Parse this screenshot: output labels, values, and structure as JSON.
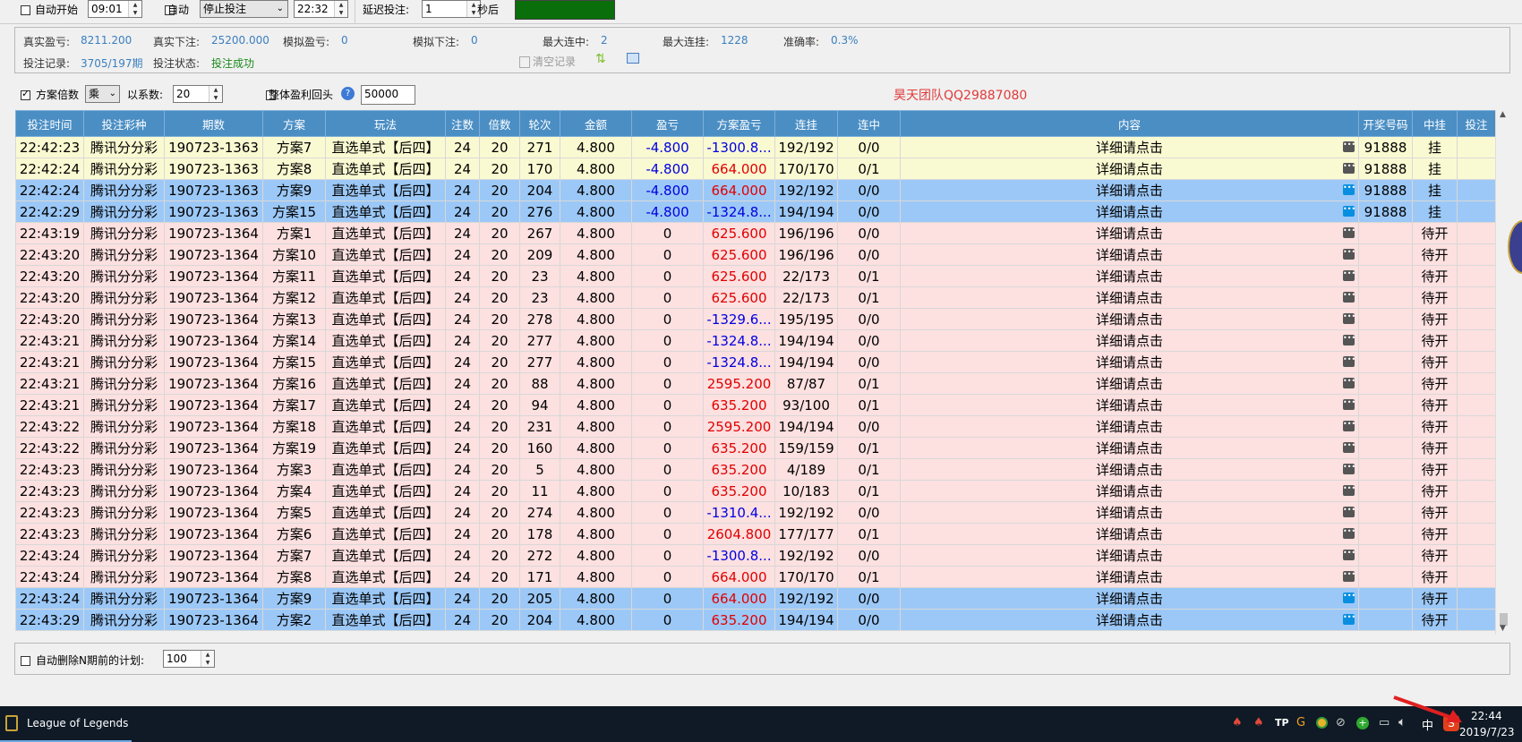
{
  "toolbar": {
    "auto_start_label": "自动开始",
    "start_time": "09:01",
    "auto_label": "自动",
    "auto_action": "停止投注",
    "end_time": "22:32",
    "delay_label": "延迟投注:",
    "delay_value": "1",
    "delay_unit": "秒后"
  },
  "stats": {
    "real_pl_label": "真实盈亏:",
    "real_pl": "8211.200",
    "real_bet_label": "真实下注:",
    "real_bet": "25200.000",
    "sim_pl_label": "模拟盈亏:",
    "sim_pl": "0",
    "sim_bet_label": "模拟下注:",
    "sim_bet": "0",
    "max_win_label": "最大连中:",
    "max_win": "2",
    "max_lose_label": "最大连挂:",
    "max_lose": "1228",
    "accuracy_label": "准确率:",
    "accuracy": "0.3%",
    "record_label": "投注记录:",
    "record": "3705/197期",
    "status_label": "投注状态:",
    "status": "投注成功",
    "clear_label": "清空记录"
  },
  "options": {
    "multiplier_label": "方案倍数",
    "multiply_op": "乘",
    "factor_label": "以系数:",
    "factor": "20",
    "overall_label": "整体盈利回头",
    "overall_value": "50000",
    "watermark": "昊天团队QQ29887080"
  },
  "table": {
    "headers": [
      "投注时间",
      "投注彩种",
      "期数",
      "方案",
      "玩法",
      "注数",
      "倍数",
      "轮次",
      "金额",
      "盈亏",
      "方案盈亏",
      "连挂",
      "连中",
      "内容",
      "开奖号码",
      "中挂",
      "投注"
    ],
    "rows": [
      {
        "style": "y",
        "c": [
          "22:42:23",
          "腾讯分分彩",
          "190723-1363",
          "方案7",
          "直选单式【后四】",
          "24",
          "20",
          "271",
          "4.800",
          "-4.800",
          "-1300.8...",
          "192/192",
          "0/0",
          "详细请点击",
          "91888",
          "挂",
          ""
        ],
        "pl": "neg",
        "spl": "neg",
        "dot": "gray"
      },
      {
        "style": "y",
        "c": [
          "22:42:24",
          "腾讯分分彩",
          "190723-1363",
          "方案8",
          "直选单式【后四】",
          "24",
          "20",
          "170",
          "4.800",
          "-4.800",
          "664.000",
          "170/170",
          "0/1",
          "详细请点击",
          "91888",
          "挂",
          ""
        ],
        "pl": "neg",
        "spl": "pos",
        "dot": "gray"
      },
      {
        "style": "b",
        "c": [
          "22:42:24",
          "腾讯分分彩",
          "190723-1363",
          "方案9",
          "直选单式【后四】",
          "24",
          "20",
          "204",
          "4.800",
          "-4.800",
          "664.000",
          "192/192",
          "0/0",
          "详细请点击",
          "91888",
          "挂",
          ""
        ],
        "pl": "neg",
        "spl": "pos",
        "dot": "blue"
      },
      {
        "style": "b",
        "c": [
          "22:42:29",
          "腾讯分分彩",
          "190723-1363",
          "方案15",
          "直选单式【后四】",
          "24",
          "20",
          "276",
          "4.800",
          "-4.800",
          "-1324.8...",
          "194/194",
          "0/0",
          "详细请点击",
          "91888",
          "挂",
          ""
        ],
        "pl": "neg",
        "spl": "neg",
        "dot": "blue"
      },
      {
        "style": "p",
        "c": [
          "22:43:19",
          "腾讯分分彩",
          "190723-1364",
          "方案1",
          "直选单式【后四】",
          "24",
          "20",
          "267",
          "4.800",
          "0",
          "625.600",
          "196/196",
          "0/0",
          "详细请点击",
          "",
          "待开",
          ""
        ],
        "pl": "",
        "spl": "pos",
        "dot": "gray"
      },
      {
        "style": "p",
        "c": [
          "22:43:20",
          "腾讯分分彩",
          "190723-1364",
          "方案10",
          "直选单式【后四】",
          "24",
          "20",
          "209",
          "4.800",
          "0",
          "625.600",
          "196/196",
          "0/0",
          "详细请点击",
          "",
          "待开",
          ""
        ],
        "pl": "",
        "spl": "pos",
        "dot": "gray"
      },
      {
        "style": "p",
        "c": [
          "22:43:20",
          "腾讯分分彩",
          "190723-1364",
          "方案11",
          "直选单式【后四】",
          "24",
          "20",
          "23",
          "4.800",
          "0",
          "625.600",
          "22/173",
          "0/1",
          "详细请点击",
          "",
          "待开",
          ""
        ],
        "pl": "",
        "spl": "pos",
        "dot": "gray"
      },
      {
        "style": "p",
        "c": [
          "22:43:20",
          "腾讯分分彩",
          "190723-1364",
          "方案12",
          "直选单式【后四】",
          "24",
          "20",
          "23",
          "4.800",
          "0",
          "625.600",
          "22/173",
          "0/1",
          "详细请点击",
          "",
          "待开",
          ""
        ],
        "pl": "",
        "spl": "pos",
        "dot": "gray"
      },
      {
        "style": "p",
        "c": [
          "22:43:20",
          "腾讯分分彩",
          "190723-1364",
          "方案13",
          "直选单式【后四】",
          "24",
          "20",
          "278",
          "4.800",
          "0",
          "-1329.6...",
          "195/195",
          "0/0",
          "详细请点击",
          "",
          "待开",
          ""
        ],
        "pl": "",
        "spl": "neg",
        "dot": "gray"
      },
      {
        "style": "p",
        "c": [
          "22:43:21",
          "腾讯分分彩",
          "190723-1364",
          "方案14",
          "直选单式【后四】",
          "24",
          "20",
          "277",
          "4.800",
          "0",
          "-1324.8...",
          "194/194",
          "0/0",
          "详细请点击",
          "",
          "待开",
          ""
        ],
        "pl": "",
        "spl": "neg",
        "dot": "gray"
      },
      {
        "style": "p",
        "c": [
          "22:43:21",
          "腾讯分分彩",
          "190723-1364",
          "方案15",
          "直选单式【后四】",
          "24",
          "20",
          "277",
          "4.800",
          "0",
          "-1324.8...",
          "194/194",
          "0/0",
          "详细请点击",
          "",
          "待开",
          ""
        ],
        "pl": "",
        "spl": "neg",
        "dot": "gray"
      },
      {
        "style": "p",
        "c": [
          "22:43:21",
          "腾讯分分彩",
          "190723-1364",
          "方案16",
          "直选单式【后四】",
          "24",
          "20",
          "88",
          "4.800",
          "0",
          "2595.200",
          "87/87",
          "0/1",
          "详细请点击",
          "",
          "待开",
          ""
        ],
        "pl": "",
        "spl": "pos",
        "dot": "gray"
      },
      {
        "style": "p",
        "c": [
          "22:43:21",
          "腾讯分分彩",
          "190723-1364",
          "方案17",
          "直选单式【后四】",
          "24",
          "20",
          "94",
          "4.800",
          "0",
          "635.200",
          "93/100",
          "0/1",
          "详细请点击",
          "",
          "待开",
          ""
        ],
        "pl": "",
        "spl": "pos",
        "dot": "gray"
      },
      {
        "style": "p",
        "c": [
          "22:43:22",
          "腾讯分分彩",
          "190723-1364",
          "方案18",
          "直选单式【后四】",
          "24",
          "20",
          "231",
          "4.800",
          "0",
          "2595.200",
          "194/194",
          "0/0",
          "详细请点击",
          "",
          "待开",
          ""
        ],
        "pl": "",
        "spl": "pos",
        "dot": "gray"
      },
      {
        "style": "p",
        "c": [
          "22:43:22",
          "腾讯分分彩",
          "190723-1364",
          "方案19",
          "直选单式【后四】",
          "24",
          "20",
          "160",
          "4.800",
          "0",
          "635.200",
          "159/159",
          "0/1",
          "详细请点击",
          "",
          "待开",
          ""
        ],
        "pl": "",
        "spl": "pos",
        "dot": "gray"
      },
      {
        "style": "p",
        "c": [
          "22:43:23",
          "腾讯分分彩",
          "190723-1364",
          "方案3",
          "直选单式【后四】",
          "24",
          "20",
          "5",
          "4.800",
          "0",
          "635.200",
          "4/189",
          "0/1",
          "详细请点击",
          "",
          "待开",
          ""
        ],
        "pl": "",
        "spl": "pos",
        "dot": "gray"
      },
      {
        "style": "p",
        "c": [
          "22:43:23",
          "腾讯分分彩",
          "190723-1364",
          "方案4",
          "直选单式【后四】",
          "24",
          "20",
          "11",
          "4.800",
          "0",
          "635.200",
          "10/183",
          "0/1",
          "详细请点击",
          "",
          "待开",
          ""
        ],
        "pl": "",
        "spl": "pos",
        "dot": "gray"
      },
      {
        "style": "p",
        "c": [
          "22:43:23",
          "腾讯分分彩",
          "190723-1364",
          "方案5",
          "直选单式【后四】",
          "24",
          "20",
          "274",
          "4.800",
          "0",
          "-1310.4...",
          "192/192",
          "0/0",
          "详细请点击",
          "",
          "待开",
          ""
        ],
        "pl": "",
        "spl": "neg",
        "dot": "gray"
      },
      {
        "style": "p",
        "c": [
          "22:43:23",
          "腾讯分分彩",
          "190723-1364",
          "方案6",
          "直选单式【后四】",
          "24",
          "20",
          "178",
          "4.800",
          "0",
          "2604.800",
          "177/177",
          "0/1",
          "详细请点击",
          "",
          "待开",
          ""
        ],
        "pl": "",
        "spl": "pos",
        "dot": "gray"
      },
      {
        "style": "p",
        "c": [
          "22:43:24",
          "腾讯分分彩",
          "190723-1364",
          "方案7",
          "直选单式【后四】",
          "24",
          "20",
          "272",
          "4.800",
          "0",
          "-1300.8...",
          "192/192",
          "0/0",
          "详细请点击",
          "",
          "待开",
          ""
        ],
        "pl": "",
        "spl": "neg",
        "dot": "gray"
      },
      {
        "style": "p",
        "c": [
          "22:43:24",
          "腾讯分分彩",
          "190723-1364",
          "方案8",
          "直选单式【后四】",
          "24",
          "20",
          "171",
          "4.800",
          "0",
          "664.000",
          "170/170",
          "0/1",
          "详细请点击",
          "",
          "待开",
          ""
        ],
        "pl": "",
        "spl": "pos",
        "dot": "gray"
      },
      {
        "style": "b",
        "c": [
          "22:43:24",
          "腾讯分分彩",
          "190723-1364",
          "方案9",
          "直选单式【后四】",
          "24",
          "20",
          "205",
          "4.800",
          "0",
          "664.000",
          "192/192",
          "0/0",
          "详细请点击",
          "",
          "待开",
          ""
        ],
        "pl": "",
        "spl": "pos",
        "dot": "blue"
      },
      {
        "style": "b",
        "c": [
          "22:43:29",
          "腾讯分分彩",
          "190723-1364",
          "方案2",
          "直选单式【后四】",
          "24",
          "20",
          "204",
          "4.800",
          "0",
          "635.200",
          "194/194",
          "0/0",
          "详细请点击",
          "",
          "待开",
          ""
        ],
        "pl": "",
        "spl": "pos",
        "dot": "blue"
      }
    ]
  },
  "footer": {
    "auto_delete_label": "自动删除N期前的计划:",
    "auto_delete_value": "100"
  },
  "taskbar": {
    "app_label": "League of Legends",
    "ime": "中",
    "time": "22:44",
    "date": "2019/7/23"
  }
}
